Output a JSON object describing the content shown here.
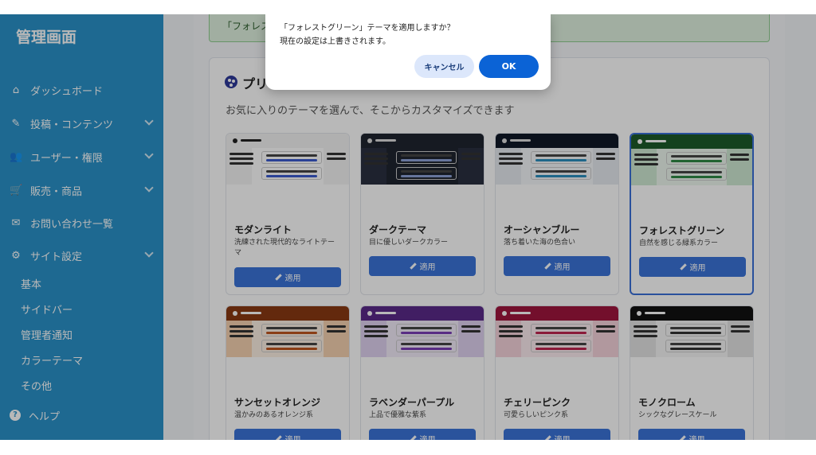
{
  "sidebar": {
    "title": "管理画面",
    "items": [
      {
        "label": "ダッシュボード",
        "icon": "home-icon",
        "glyph": "⌂"
      },
      {
        "label": "投稿・コンテンツ",
        "icon": "edit-icon",
        "glyph": "✎"
      },
      {
        "label": "ユーザー・権限",
        "icon": "users-icon",
        "glyph": "👥"
      },
      {
        "label": "販売・商品",
        "icon": "cart-icon",
        "glyph": "🛒"
      },
      {
        "label": "お問い合わせ一覧",
        "icon": "mail-icon",
        "glyph": "✉"
      },
      {
        "label": "サイト設定",
        "icon": "gear-icon",
        "glyph": "⚙"
      }
    ],
    "sub_items": [
      "基本",
      "サイドバー",
      "管理者通知",
      "カラーテーマ",
      "その他"
    ],
    "help": {
      "label": "ヘルプ",
      "icon": "help-icon",
      "glyph": "?"
    }
  },
  "main": {
    "notice": "「フォレス",
    "card_title": "プリ",
    "card_desc": "お気に入りのテーマを選んで、そこからカスタマイズできます",
    "apply_label": "適用",
    "themes": [
      {
        "name": "モダンライト",
        "desc": "洗練された現代的なライトテーマ",
        "top": "#f4f4f4",
        "accent": "#3b5bd0",
        "side": "#f4f4f4",
        "body": "#ffffff",
        "dot": "#222"
      },
      {
        "name": "ダークテーマ",
        "desc": "目に優しいダークカラー",
        "top": "#1f2430",
        "accent": "#8ea3d8",
        "side": "#2a3040",
        "body": "#1f2430",
        "dot": "#ddd"
      },
      {
        "name": "オーシャンブルー",
        "desc": "落ち着いた海の色合い",
        "top": "#101828",
        "accent": "#2a8fbf",
        "side": "#e6ebf0",
        "body": "#f4f7fa",
        "dot": "#ddd"
      },
      {
        "name": "フォレストグリーン",
        "desc": "自然を感じる緑系カラー",
        "top": "#1c5a2a",
        "accent": "#2f8a45",
        "side": "#cfe9d3",
        "body": "#eef7ef",
        "dot": "#fff"
      },
      {
        "name": "サンセットオレンジ",
        "desc": "温かみのあるオレンジ系",
        "top": "#8a3a12",
        "accent": "#c0561f",
        "side": "#f5d2b0",
        "body": "#fdf0e3",
        "dot": "#fff"
      },
      {
        "name": "ラベンダーパープル",
        "desc": "上品で優雅な紫系",
        "top": "#5b2a8a",
        "accent": "#7c3fb8",
        "side": "#e0d2f0",
        "body": "#f3ecfa",
        "dot": "#fff"
      },
      {
        "name": "チェリーピンク",
        "desc": "可愛らしいピンク系",
        "top": "#a0163e",
        "accent": "#c02450",
        "side": "#f6d3dc",
        "body": "#fcecf0",
        "dot": "#fff"
      },
      {
        "name": "モノクローム",
        "desc": "シックなグレースケール",
        "top": "#111111",
        "accent": "#333333",
        "side": "#e4e4e4",
        "body": "#f6f6f6",
        "dot": "#fff"
      }
    ]
  },
  "dialog": {
    "message_line1": "「フォレストグリーン」テーマを適用しますか？",
    "message_line2": "現在の設定は上書きされます。",
    "cancel_label": "キャンセル",
    "ok_label": "OK"
  },
  "colors": {
    "sidebar": "#2a92c9",
    "primary": "#3b74d9",
    "ok": "#0b63d6"
  }
}
